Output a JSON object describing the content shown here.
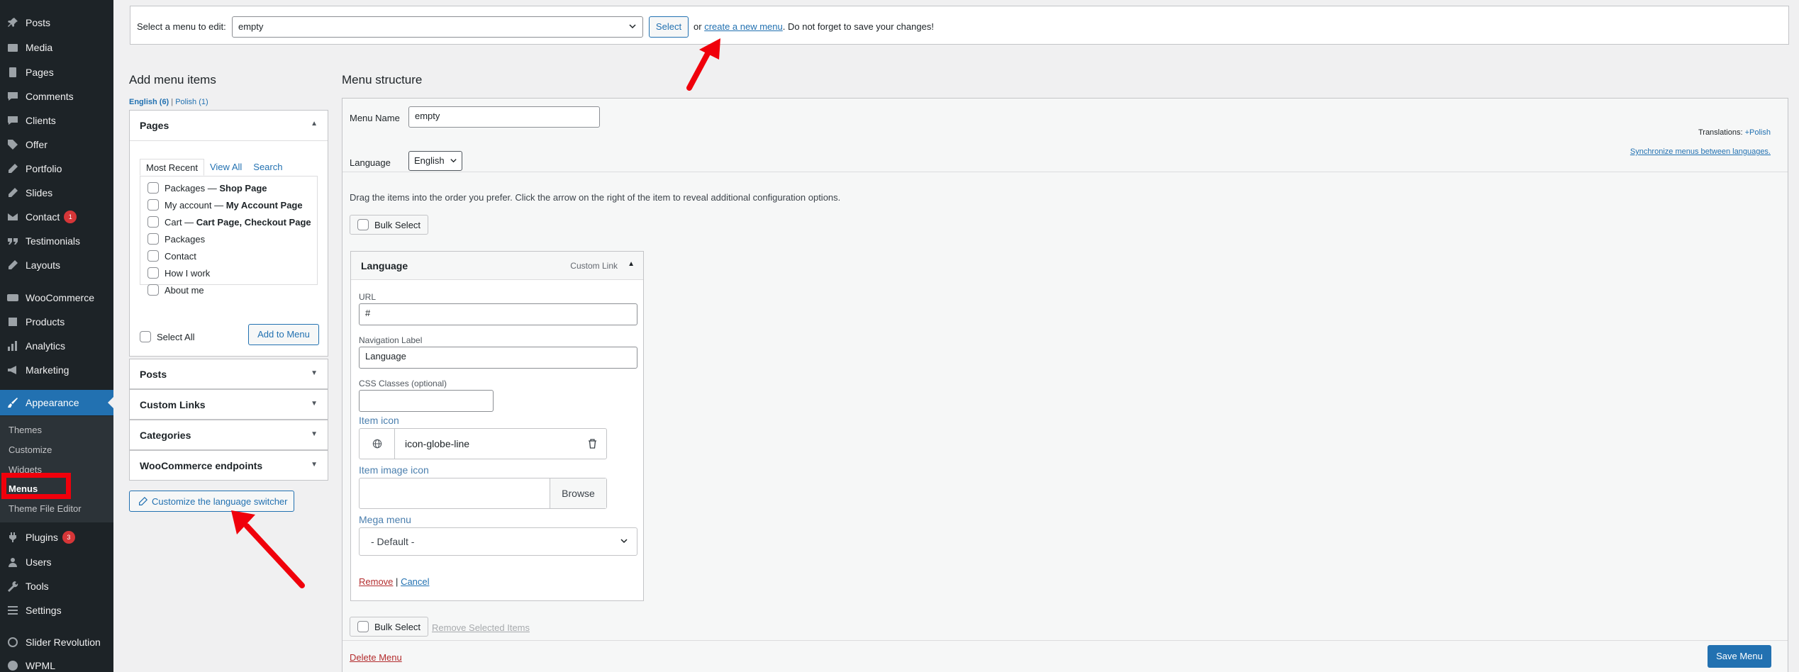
{
  "sidebar": {
    "items": [
      {
        "label": "Posts",
        "icon": "pushpin-icon"
      },
      {
        "label": "Media",
        "icon": "media-icon"
      },
      {
        "label": "Pages",
        "icon": "pages-icon"
      },
      {
        "label": "Comments",
        "icon": "comment-icon"
      },
      {
        "label": "Clients",
        "icon": "comment-icon"
      },
      {
        "label": "Offer",
        "icon": "tag-icon"
      },
      {
        "label": "Portfolio",
        "icon": "pencil-icon"
      },
      {
        "label": "Slides",
        "icon": "pencil-icon"
      },
      {
        "label": "Contact",
        "icon": "mail-icon",
        "badge": "1"
      },
      {
        "label": "Testimonials",
        "icon": "quote-icon"
      },
      {
        "label": "Layouts",
        "icon": "pencil-icon"
      },
      {
        "label": "WooCommerce",
        "icon": "woo-icon"
      },
      {
        "label": "Products",
        "icon": "box-icon"
      },
      {
        "label": "Analytics",
        "icon": "chart-icon"
      },
      {
        "label": "Marketing",
        "icon": "megaphone-icon"
      },
      {
        "label": "Appearance",
        "icon": "brush-icon"
      },
      {
        "label": "Plugins",
        "icon": "plug-icon",
        "badge": "3"
      },
      {
        "label": "Users",
        "icon": "user-icon"
      },
      {
        "label": "Tools",
        "icon": "wrench-icon"
      },
      {
        "label": "Settings",
        "icon": "settings-icon"
      },
      {
        "label": "Slider Revolution",
        "icon": "refresh-icon"
      },
      {
        "label": "WPML",
        "icon": "globe-icon"
      }
    ],
    "submenu": [
      "Themes",
      "Customize",
      "Widgets",
      "Menus",
      "Theme File Editor"
    ]
  },
  "topbar": {
    "select_label": "Select a menu to edit:",
    "selected_menu": "empty",
    "select_button": "Select",
    "or_text": "or",
    "create_link": "create a new menu",
    "tail_text": ". Do not forget to save your changes!"
  },
  "add_items": {
    "heading": "Add menu items",
    "lang_english": "English (6)",
    "separator": "|",
    "lang_polish": "Polish (1)",
    "pages_title": "Pages",
    "tabs": [
      "Most Recent",
      "View All",
      "Search"
    ],
    "pages": [
      {
        "label": "Packages",
        "suffix": "Shop Page"
      },
      {
        "label": "My account",
        "suffix": "My Account Page"
      },
      {
        "label": "Cart",
        "suffix": "Cart Page, Checkout Page"
      },
      {
        "label": "Packages",
        "suffix": ""
      },
      {
        "label": "Contact",
        "suffix": ""
      },
      {
        "label": "How I work",
        "suffix": ""
      },
      {
        "label": "About me",
        "suffix": ""
      }
    ],
    "select_all": "Select All",
    "add_button": "Add to Menu",
    "accordions": [
      "Posts",
      "Custom Links",
      "Categories",
      "WooCommerce endpoints"
    ],
    "customize_button": "Customize the language switcher"
  },
  "structure": {
    "heading": "Menu structure",
    "name_label": "Menu Name",
    "name_value": "empty",
    "language_label": "Language",
    "language_value": "English",
    "translations_label": "Translations:",
    "translations_link": "Polish",
    "sync_link": "Synchronize menus between languages.",
    "drag_text": "Drag the items into the order you prefer. Click the arrow on the right of the item to reveal additional configuration options.",
    "bulk_select": "Bulk Select",
    "remove_selected": "Remove Selected Items",
    "item": {
      "title": "Language",
      "type": "Custom Link",
      "url_label": "URL",
      "url_value": "#",
      "nav_label": "Navigation Label",
      "nav_value": "Language",
      "css_label": "CSS Classes (optional)",
      "css_value": "",
      "icon_label": "Item icon",
      "icon_value": "icon-globe-line",
      "image_label": "Item image icon",
      "browse": "Browse",
      "mega_label": "Mega menu",
      "mega_value": "- Default -",
      "remove": "Remove",
      "sep": "|",
      "cancel": "Cancel"
    },
    "delete_menu": "Delete Menu",
    "save_button": "Save Menu"
  },
  "colors": {
    "accent": "#2271b1",
    "sidebar": "#1d2327",
    "annotation": "#f0000b"
  }
}
